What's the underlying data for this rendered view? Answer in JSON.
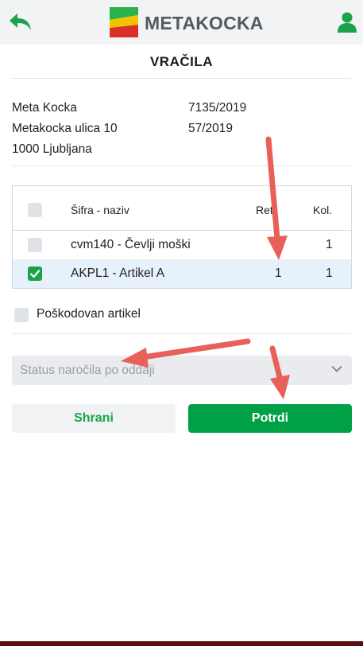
{
  "header": {
    "back_icon": "back-arrow-icon",
    "logo_text": "METAKOCKA",
    "user_icon": "user-icon",
    "accent_color": "#1aa34a"
  },
  "page": {
    "title": "VRAČILA"
  },
  "info": {
    "name": "Meta Kocka",
    "street": "Metakocka ulica 10",
    "city": "1000 Ljubljana",
    "doc_number_1": "7135/2019",
    "doc_number_2": "57/2019"
  },
  "table": {
    "headers": {
      "code_name": "Šifra - naziv",
      "ret": "Ret.",
      "qty": "Kol."
    },
    "rows": [
      {
        "checked": false,
        "code_name": "cvm140 - Čevlji moški",
        "ret": "",
        "qty": "1"
      },
      {
        "checked": true,
        "code_name": "AKPL1 - Artikel A",
        "ret": "1",
        "qty": "1"
      }
    ]
  },
  "damaged": {
    "label": "Poškodovan artikel",
    "checked": false
  },
  "status_select": {
    "placeholder": "Status naročila po oddaji"
  },
  "buttons": {
    "save": "Shrani",
    "confirm": "Potrdi"
  }
}
